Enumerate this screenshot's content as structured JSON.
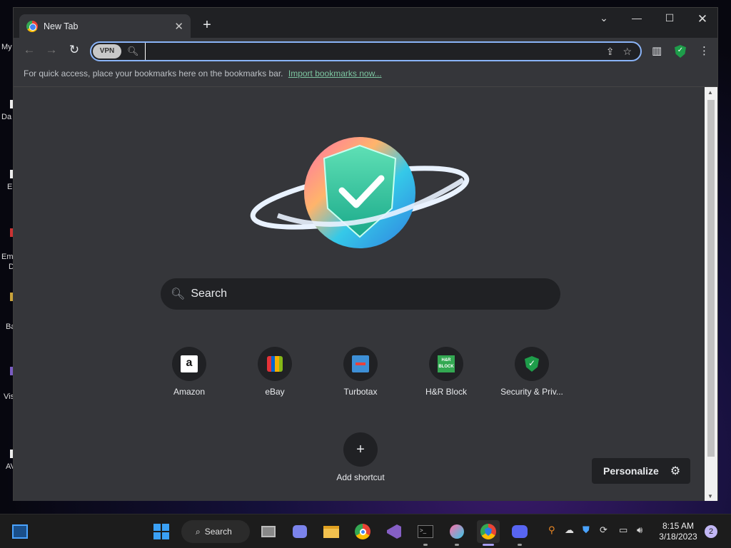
{
  "desktop": {
    "labels": [
      "My",
      "Da",
      "E",
      "Em",
      "D",
      "Ba",
      "Vis",
      "AV"
    ]
  },
  "browser": {
    "tab": {
      "title": "New Tab"
    },
    "omnibox": {
      "vpn_label": "VPN",
      "value": ""
    },
    "bookmarks_bar": {
      "message": "For quick access, place your bookmarks here on the bookmarks bar.",
      "import_link": "Import bookmarks now..."
    },
    "newtab": {
      "search_placeholder": "Search",
      "shortcuts": [
        {
          "label": "Amazon",
          "icon": "amazon-icon"
        },
        {
          "label": "eBay",
          "icon": "ebay-icon"
        },
        {
          "label": "Turbotax",
          "icon": "turbotax-icon"
        },
        {
          "label": "H&R Block",
          "icon": "hrblock-icon",
          "icon_text": "H&R BLOCK"
        },
        {
          "label": "Security & Priv...",
          "icon": "shield-check-icon"
        }
      ],
      "add_shortcut": "Add shortcut",
      "personalize": "Personalize"
    }
  },
  "taskbar": {
    "search_label": "Search",
    "time": "8:15 AM",
    "date": "3/18/2023",
    "notification_count": "2"
  },
  "colors": {
    "accent": "#8ab4f8",
    "link": "#7cc5a0",
    "shield_green": "#1e9d4a"
  }
}
